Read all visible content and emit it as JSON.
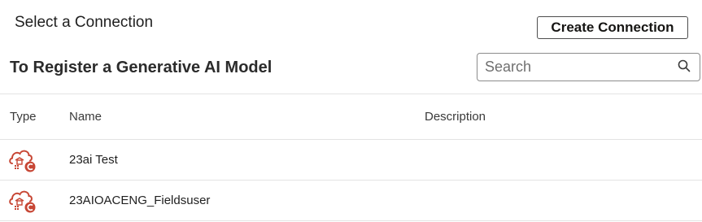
{
  "header": {
    "title": "Select a Connection",
    "create_button_label": "Create Connection"
  },
  "section": {
    "title": "To Register a Generative AI Model"
  },
  "search": {
    "placeholder": "Search",
    "value": "",
    "icon": "search-icon"
  },
  "table": {
    "columns": [
      "Type",
      "Name",
      "Description"
    ],
    "rows": [
      {
        "type_icon": "cloud-database-icon",
        "name": "23ai Test",
        "description": ""
      },
      {
        "type_icon": "cloud-database-icon",
        "name": "23AIOACENG_Fieldsuser",
        "description": ""
      }
    ]
  },
  "colors": {
    "accent_red": "#c74634",
    "border": "#e3e3e3"
  }
}
